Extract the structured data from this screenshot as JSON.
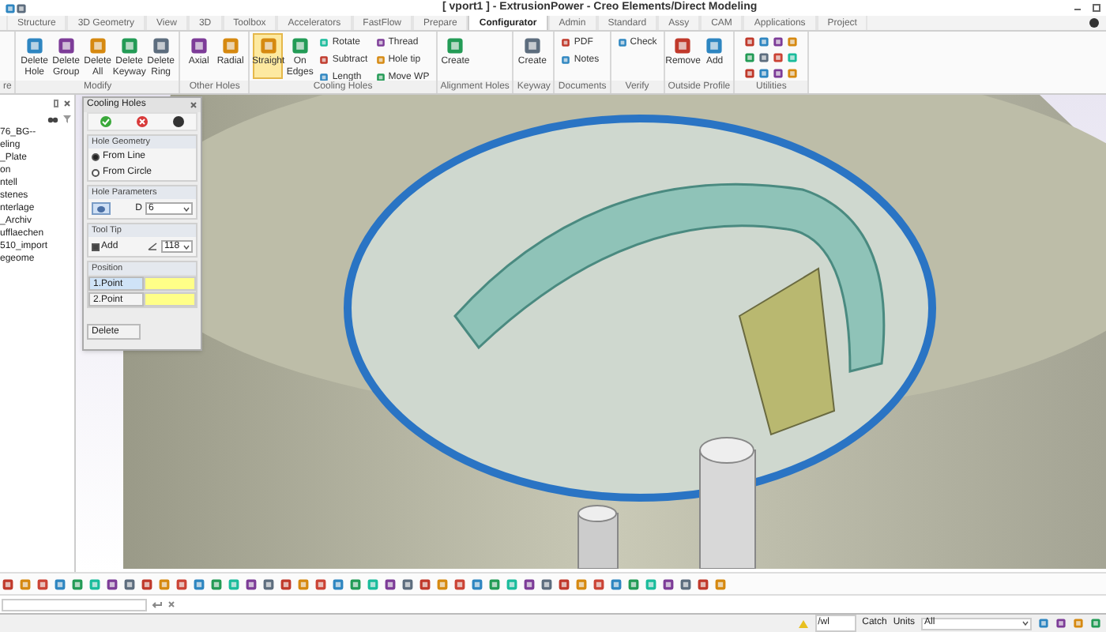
{
  "window": {
    "title": "[ vport1 ] - ExtrusionPower - Creo Elements/Direct Modeling"
  },
  "tabs": [
    {
      "label": "Structure",
      "selected": false
    },
    {
      "label": "3D Geometry",
      "selected": false
    },
    {
      "label": "View",
      "selected": false
    },
    {
      "label": "3D",
      "selected": false
    },
    {
      "label": "Toolbox",
      "selected": false
    },
    {
      "label": "Accelerators",
      "selected": false
    },
    {
      "label": "FastFlow",
      "selected": false
    },
    {
      "label": "Prepare",
      "selected": false
    },
    {
      "label": "Configurator",
      "selected": true
    },
    {
      "label": "Admin",
      "selected": false
    },
    {
      "label": "Standard",
      "selected": false
    },
    {
      "label": "Assy",
      "selected": false
    },
    {
      "label": "CAM",
      "selected": false
    },
    {
      "label": "Applications",
      "selected": false
    },
    {
      "label": "Project",
      "selected": false
    }
  ],
  "ribbon_groups": [
    {
      "label": "re",
      "kind": "buttons"
    },
    {
      "label": "Modify",
      "kind": "buttons",
      "buttons": [
        {
          "label": "Delete Hole",
          "kind": "large",
          "selected": false
        },
        {
          "label": "Delete Group",
          "kind": "large",
          "selected": false
        },
        {
          "label": "Delete All",
          "kind": "large",
          "selected": false
        },
        {
          "label": "Delete Keyway",
          "kind": "large",
          "selected": false
        },
        {
          "label": "Delete Ring",
          "kind": "large",
          "selected": false
        }
      ]
    },
    {
      "label": "Other Holes",
      "kind": "buttons",
      "buttons": [
        {
          "label": "Axial",
          "kind": "large",
          "selected": false
        },
        {
          "label": "Radial",
          "kind": "large",
          "selected": false
        }
      ]
    },
    {
      "label": "Cooling Holes",
      "kind": "buttons",
      "buttons": [
        {
          "label": "Straight",
          "kind": "large",
          "selected": true
        },
        {
          "label": "On Edges",
          "kind": "large",
          "selected": false
        },
        {
          "label": "Rotate",
          "kind": "small",
          "selected": false
        },
        {
          "label": "Subtract",
          "kind": "small",
          "selected": false
        },
        {
          "label": "Length",
          "kind": "small",
          "selected": false
        },
        {
          "label": "Thread",
          "kind": "small",
          "selected": false
        },
        {
          "label": "Hole tip",
          "kind": "small",
          "selected": false
        },
        {
          "label": "Move WP",
          "kind": "small",
          "selected": false
        }
      ]
    },
    {
      "label": "Alignment Holes",
      "kind": "buttons",
      "buttons": [
        {
          "label": "Create",
          "kind": "large",
          "selected": false
        }
      ]
    },
    {
      "label": "Keyway",
      "kind": "buttons",
      "buttons": [
        {
          "label": "Create",
          "kind": "large",
          "selected": false
        }
      ]
    },
    {
      "label": "Documents",
      "kind": "buttons",
      "buttons": [
        {
          "label": "PDF",
          "kind": "small",
          "selected": false
        },
        {
          "label": "Notes",
          "kind": "small",
          "selected": false
        }
      ]
    },
    {
      "label": "Verify",
      "kind": "buttons",
      "buttons": [
        {
          "label": "Check",
          "kind": "small",
          "selected": false
        }
      ]
    },
    {
      "label": "Outside Profile",
      "kind": "buttons",
      "buttons": [
        {
          "label": "Remove",
          "kind": "large",
          "selected": false
        },
        {
          "label": "Add",
          "kind": "large",
          "selected": false
        }
      ]
    },
    {
      "label": "Utilities",
      "kind": "icons"
    }
  ],
  "tree": {
    "items": [
      "76_BG--",
      "eling",
      "_Plate",
      "on",
      "ntell",
      "stenes",
      "nterlage",
      "_Archiv",
      "ufflaechen",
      "510_import",
      "egeome"
    ]
  },
  "dialog": {
    "title": "Cooling Holes",
    "sections": [
      {
        "title": "Hole Geometry",
        "kind": "radios",
        "options": [
          {
            "label": "From Line",
            "selected": true
          },
          {
            "label": "From Circle",
            "selected": false
          }
        ]
      },
      {
        "title": "Hole Parameters",
        "kind": "param",
        "label": "D",
        "value": "6"
      },
      {
        "title": "Tool Tip",
        "kind": "tip",
        "checkbox": {
          "label": "Add",
          "checked": true
        },
        "value": "118"
      },
      {
        "title": "Position",
        "kind": "points",
        "rows": [
          {
            "label": "1.Point",
            "selected": true
          },
          {
            "label": "2.Point",
            "selected": false
          }
        ]
      }
    ],
    "delete_button": "Delete"
  },
  "status_bar": {
    "field": "/wl",
    "catch": "Catch",
    "units_label": "Units",
    "units_value": "All"
  }
}
